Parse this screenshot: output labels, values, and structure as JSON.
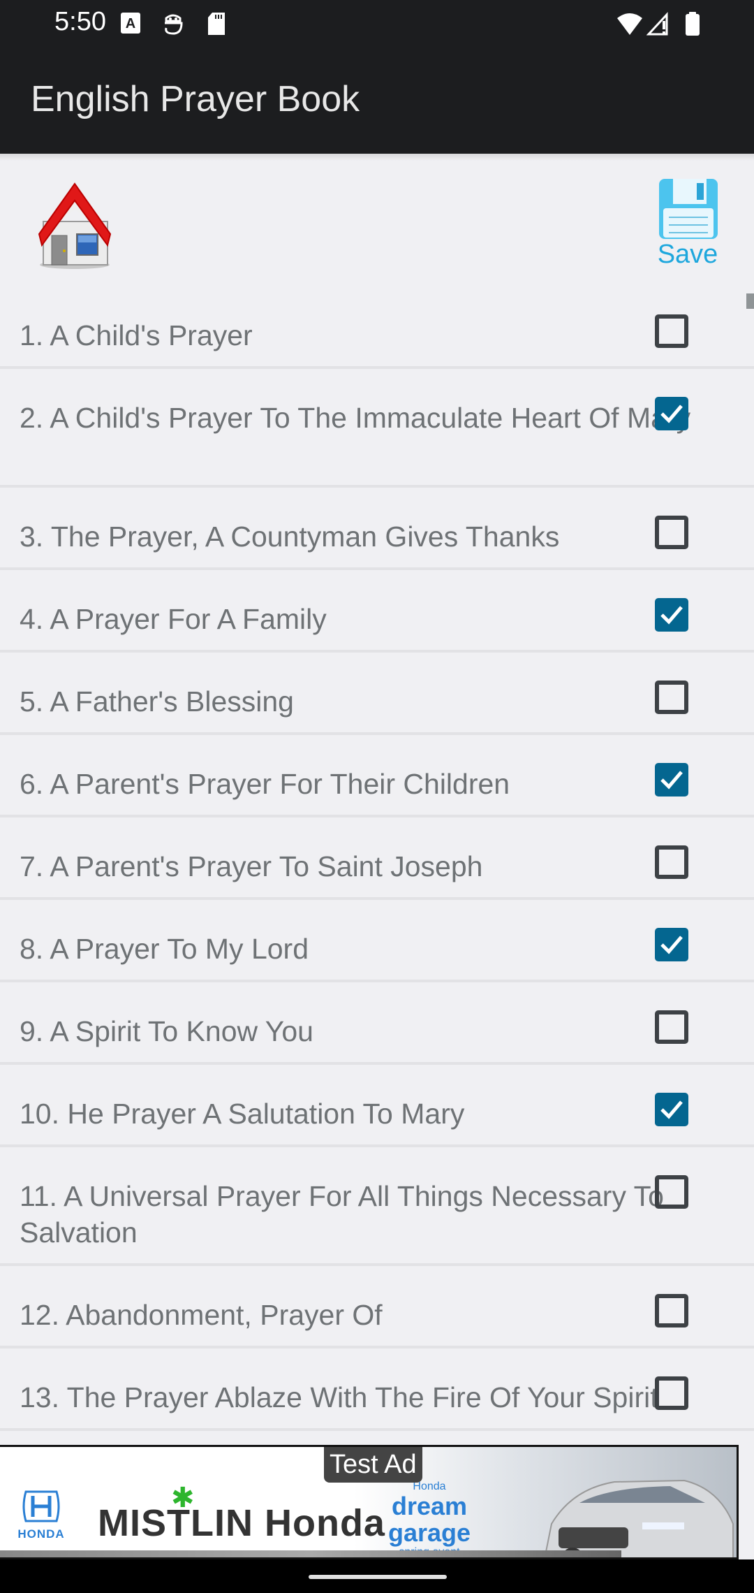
{
  "status_bar": {
    "time": "5:50",
    "left_icons": [
      "text-a-notification-icon",
      "android-debug-icon",
      "sd-card-icon"
    ],
    "right_icons": [
      "wifi-icon",
      "signal-no-service-icon",
      "battery-icon"
    ]
  },
  "app_bar": {
    "title": "English Prayer Book"
  },
  "toolbar": {
    "home_icon": "home-icon",
    "save_icon": "floppy-disk-icon",
    "save_label": "Save"
  },
  "prayers": [
    {
      "label": "1. A Child's Prayer",
      "checked": false,
      "lines": 1
    },
    {
      "label": "2. A Child's Prayer To The Immaculate Heart Of Mary",
      "checked": true,
      "lines": 2
    },
    {
      "label": "3. The Prayer, A Countyman Gives Thanks",
      "checked": false,
      "lines": 1
    },
    {
      "label": "4. A Prayer For A Family",
      "checked": true,
      "lines": 1
    },
    {
      "label": "5. A Father's Blessing",
      "checked": false,
      "lines": 1
    },
    {
      "label": "6. A Parent's Prayer For Their Children",
      "checked": true,
      "lines": 1
    },
    {
      "label": "7. A Parent's Prayer To Saint Joseph",
      "checked": false,
      "lines": 1
    },
    {
      "label": "8. A Prayer To My Lord",
      "checked": true,
      "lines": 1
    },
    {
      "label": "9. A Spirit To Know You",
      "checked": false,
      "lines": 1
    },
    {
      "label": "10. He Prayer A Salutation To Mary",
      "checked": true,
      "lines": 1
    },
    {
      "label": "11. A Universal Prayer For All Things Necessary To Salvation",
      "checked": false,
      "lines": 2
    },
    {
      "label": "12. Abandonment, Prayer Of",
      "checked": false,
      "lines": 1
    },
    {
      "label": "13. The Prayer Ablaze With The Fire Of Your Spirit",
      "checked": false,
      "lines": 1
    }
  ],
  "ad": {
    "badge": "Test Ad",
    "honda_word": "HONDA",
    "brand": "MISTLIN Honda",
    "event_top": "Honda",
    "event_main": "dream garage",
    "event_sub": "spring event"
  },
  "colors": {
    "app_bar_bg": "#1c1d1f",
    "background": "#f0f0f3",
    "checkbox_checked": "#046690",
    "checkbox_unchecked_border": "#3d4145",
    "row_text": "#6e7275",
    "save_accent": "#1ea7dd"
  }
}
